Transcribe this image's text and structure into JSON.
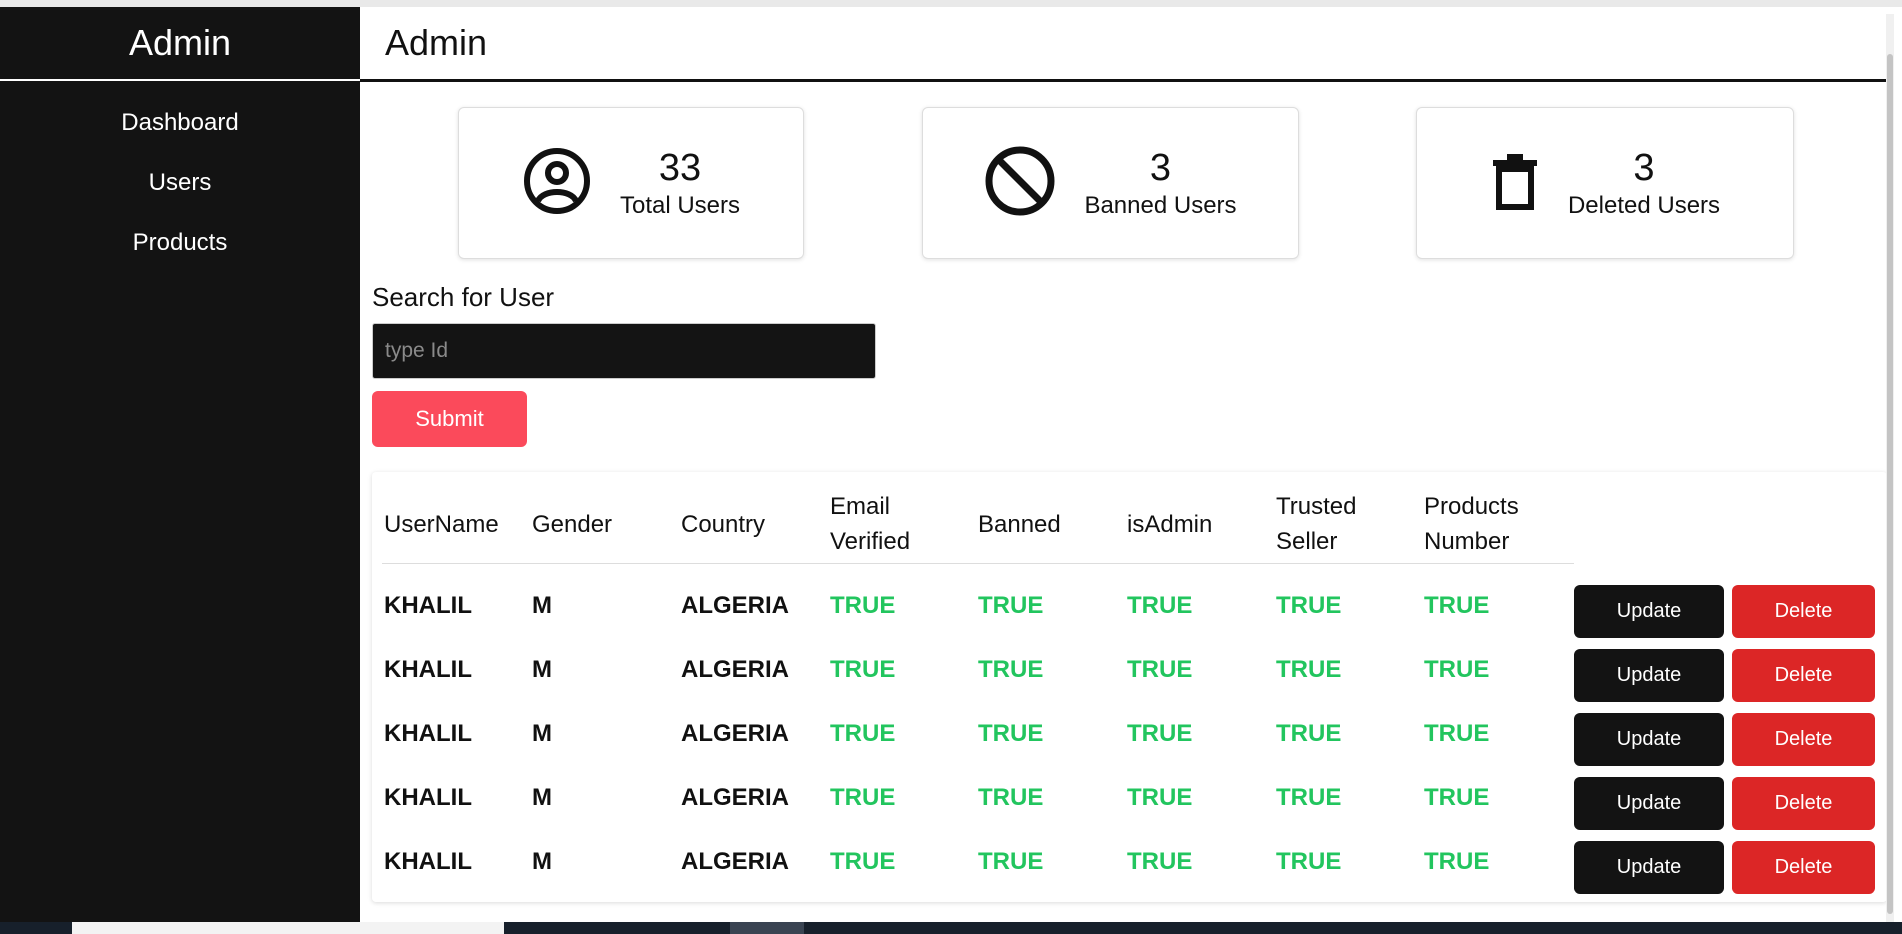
{
  "sidebar": {
    "brand": "Admin",
    "items": [
      {
        "label": "Dashboard"
      },
      {
        "label": "Users"
      },
      {
        "label": "Products"
      }
    ]
  },
  "header": {
    "title": "Admin"
  },
  "stats": [
    {
      "value": "33",
      "label": "Total Users",
      "icon": "user-circle-icon"
    },
    {
      "value": "3",
      "label": "Banned Users",
      "icon": "ban-icon"
    },
    {
      "value": "3",
      "label": "Deleted Users",
      "icon": "trash-icon"
    }
  ],
  "search": {
    "label": "Search for User",
    "placeholder": "type Id",
    "value": "",
    "submit_label": "Submit"
  },
  "table": {
    "headers": [
      "UserName",
      "Gender",
      "Country",
      "Email\nVerified",
      "Banned",
      "isAdmin",
      "Trusted\nSeller",
      "Products\nNumber"
    ],
    "rows": [
      [
        "KHALIL",
        "M",
        "ALGERIA",
        "TRUE",
        "TRUE",
        "TRUE",
        "TRUE",
        "TRUE"
      ],
      [
        "KHALIL",
        "M",
        "ALGERIA",
        "TRUE",
        "TRUE",
        "TRUE",
        "TRUE",
        "TRUE"
      ],
      [
        "KHALIL",
        "M",
        "ALGERIA",
        "TRUE",
        "TRUE",
        "TRUE",
        "TRUE",
        "TRUE"
      ],
      [
        "KHALIL",
        "M",
        "ALGERIA",
        "TRUE",
        "TRUE",
        "TRUE",
        "TRUE",
        "TRUE"
      ],
      [
        "KHALIL",
        "M",
        "ALGERIA",
        "TRUE",
        "TRUE",
        "TRUE",
        "TRUE",
        "TRUE"
      ]
    ],
    "update_label": "Update",
    "delete_label": "Delete"
  },
  "colors": {
    "sidebar_bg": "#131313",
    "accent_submit": "#fb4a5b",
    "delete_red": "#dc2626",
    "true_green": "#22c55e"
  }
}
